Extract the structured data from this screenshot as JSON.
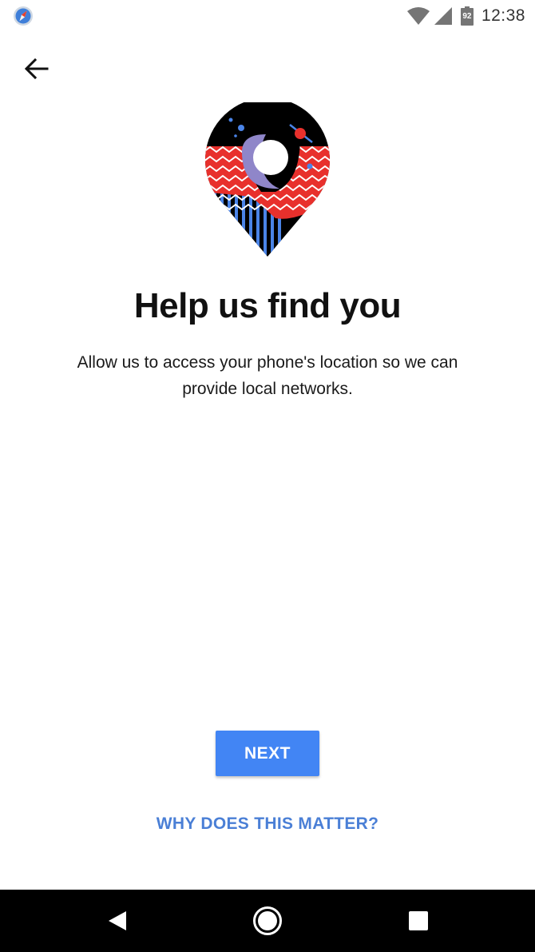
{
  "status_bar": {
    "time": "12:38",
    "battery_level": "92",
    "app_icon": "compass-app-icon",
    "icons": [
      "wifi-icon",
      "cell-signal-icon",
      "battery-icon"
    ]
  },
  "header": {
    "back_icon": "arrow-left-icon"
  },
  "main": {
    "illustration": "location-pin-illustration",
    "title": "Help us find you",
    "description": "Allow us to access your phone's location so we can provide local networks."
  },
  "actions": {
    "next_label": "NEXT",
    "why_label": "WHY DOES THIS MATTER?"
  },
  "nav_bar": {
    "icons": [
      "nav-back-icon",
      "nav-home-icon",
      "nav-recents-icon"
    ]
  },
  "colors": {
    "accent": "#4285f4",
    "link": "#4a7fd6",
    "pin_black": "#000000",
    "pin_red": "#e8302c",
    "pin_blue": "#4a84e8",
    "pin_lavender": "#8f86c9"
  }
}
